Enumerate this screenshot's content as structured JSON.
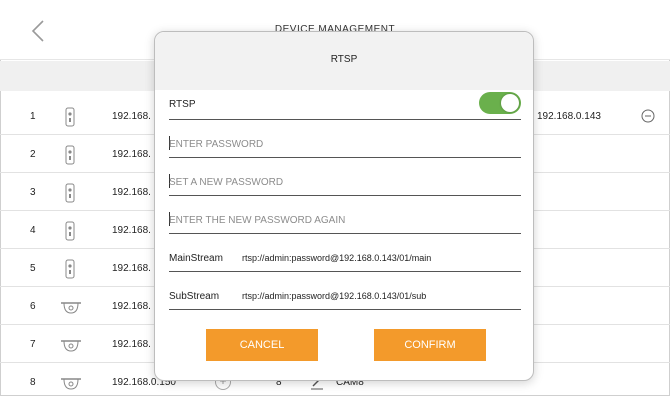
{
  "header": {
    "title": "DEVICE MANAGEMENT",
    "back_icon": "chevron-left-icon"
  },
  "rows": [
    {
      "num": "1",
      "ip": "192.168.",
      "type": "bullet",
      "remote_ip": "192.168.0.143"
    },
    {
      "num": "2",
      "ip": "192.168.",
      "type": "bullet"
    },
    {
      "num": "3",
      "ip": "192.168.",
      "type": "bullet"
    },
    {
      "num": "4",
      "ip": "192.168.",
      "type": "bullet"
    },
    {
      "num": "5",
      "ip": "192.168.",
      "type": "bullet"
    },
    {
      "num": "6",
      "ip": "192.168.",
      "type": "dome"
    },
    {
      "num": "7",
      "ip": "192.168.",
      "type": "dome"
    },
    {
      "num": "8",
      "ip": "192.168.0.150",
      "type": "dome",
      "channel": "8",
      "name": "CAM8"
    }
  ],
  "dialog": {
    "title": "RTSP",
    "rtsp_label": "RTSP",
    "rtsp_enabled": true,
    "enter_password_placeholder": "ENTER PASSWORD",
    "new_password_placeholder": "SET A NEW PASSWORD",
    "confirm_password_placeholder": "ENTER THE NEW PASSWORD AGAIN",
    "mainstream_label": "MainStream",
    "mainstream_url": "rtsp://admin:password@192.168.0.143/01/main",
    "substream_label": "SubStream",
    "substream_url": "rtsp://admin:password@192.168.0.143/01/sub",
    "cancel_label": "CANCEL",
    "confirm_label": "CONFIRM"
  },
  "colors": {
    "accent": "#f39a2b",
    "toggle_on": "#6ab04c"
  }
}
